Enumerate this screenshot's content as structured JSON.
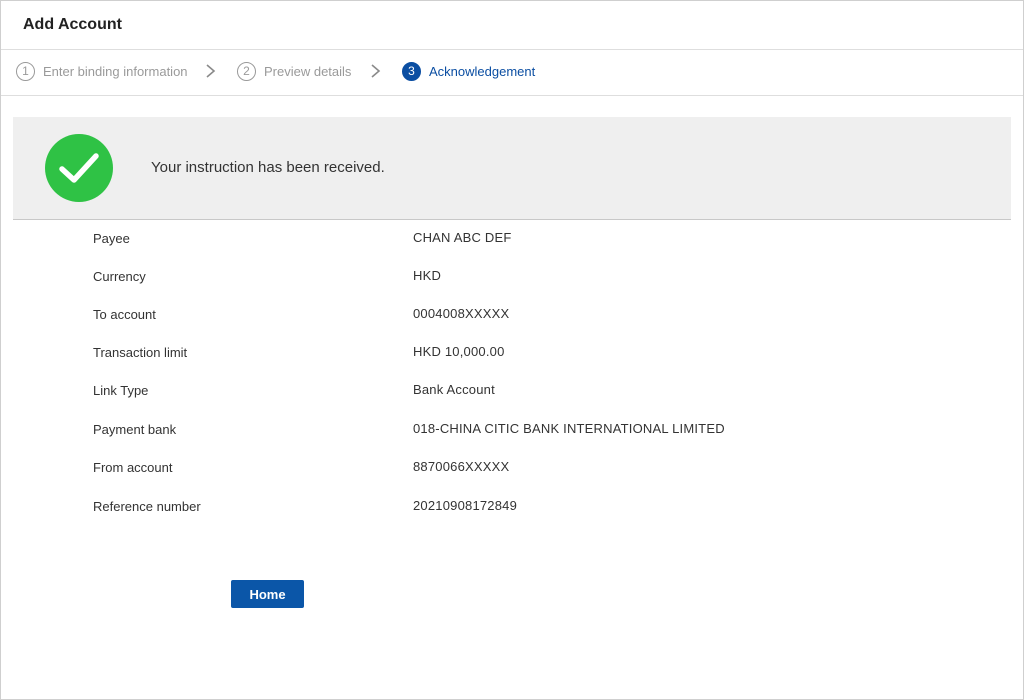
{
  "header": {
    "title": "Add Account"
  },
  "stepper": {
    "steps": [
      {
        "number": "1",
        "label": "Enter binding information",
        "state": "completed"
      },
      {
        "number": "2",
        "label": "Preview details",
        "state": "completed"
      },
      {
        "number": "3",
        "label": "Acknowledgement",
        "state": "active"
      }
    ]
  },
  "banner": {
    "icon": "checkmark-circle-icon",
    "message": "Your instruction has been received."
  },
  "details": {
    "rows": [
      {
        "label": "Payee",
        "value": "CHAN ABC DEF"
      },
      {
        "label": "Currency",
        "value": "HKD"
      },
      {
        "label": "To account",
        "value": "0004008XXXXX"
      },
      {
        "label": "Transaction limit",
        "value": "HKD 10,000.00"
      },
      {
        "label": "Link Type",
        "value": "Bank Account"
      },
      {
        "label": "Payment bank",
        "value": "018-CHINA CITIC BANK INTERNATIONAL LIMITED"
      },
      {
        "label": "From account",
        "value": "8870066XXXXX"
      },
      {
        "label": "Reference number",
        "value": "20210908172849"
      }
    ]
  },
  "actions": {
    "home_label": "Home"
  },
  "colors": {
    "accent": "#0b4ea2",
    "success": "#2fc245",
    "banner_bg": "#efefef",
    "inactive_step": "#9a9a9a"
  }
}
